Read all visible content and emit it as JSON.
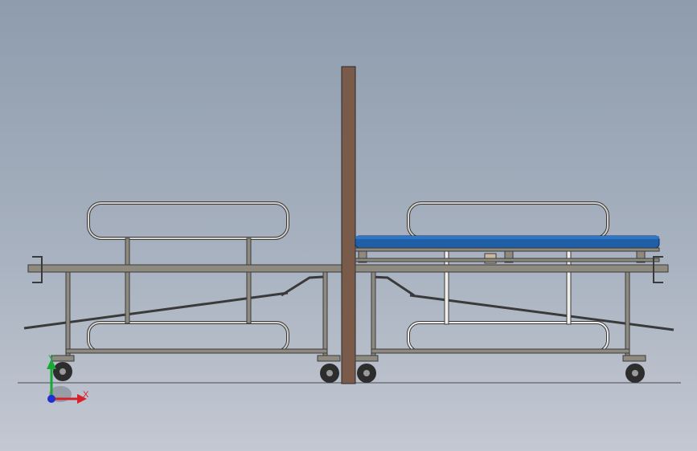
{
  "viewport": {
    "background_top": "#8e9cad",
    "background_bottom": "#c3c8d2"
  },
  "model": {
    "frame_color": "#8f8a80",
    "frame_dark": "#3a3a3a",
    "rail_fill": "#cfcdc8",
    "post_color": "#7a5a48",
    "mattress_color": "#1f5fa8"
  },
  "triad": {
    "x_label": "X",
    "y_label": "Y",
    "x_color": "#d8202a",
    "y_color": "#18a838",
    "z_color": "#2030d0"
  }
}
